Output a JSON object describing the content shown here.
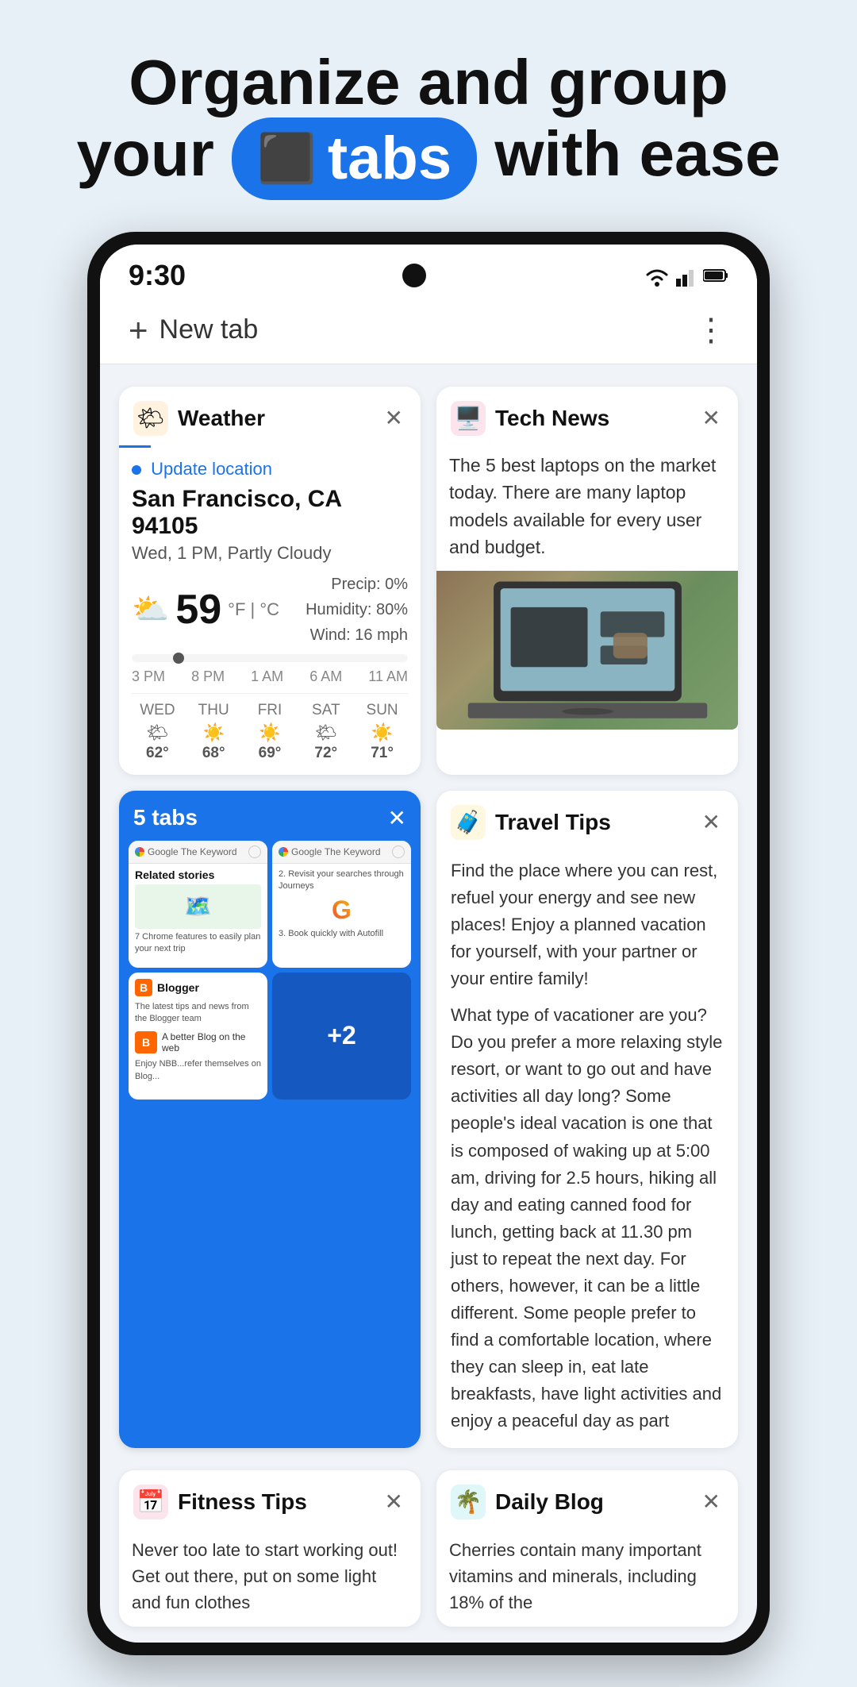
{
  "hero": {
    "line1": "Organize and group",
    "line2pre": "your",
    "badge_icon": "⬛",
    "badge_text": "tabs",
    "line2post": "with ease"
  },
  "phone": {
    "status": {
      "time": "9:30"
    },
    "nav": {
      "new_tab_label": "New tab"
    },
    "weather_card": {
      "title": "Weather",
      "update_text": "Update location",
      "location": "San Francisco, CA 94105",
      "conditions": "Wed, 1 PM, Partly Cloudy",
      "temp": "59",
      "temp_unit": "°F | °C",
      "precip": "Precip: 0%",
      "humidity": "Humidity: 80%",
      "wind": "Wind: 16 mph",
      "timeline_labels": [
        "3 PM",
        "8 PM",
        "1 AM",
        "6 AM",
        "11 AM"
      ],
      "forecast": [
        {
          "day": "WED",
          "icon": "🌤",
          "temp": "62°"
        },
        {
          "day": "THU",
          "icon": "☀️",
          "temp": "68°"
        },
        {
          "day": "FRI",
          "icon": "☀️",
          "temp": "69°"
        },
        {
          "day": "SAT",
          "icon": "🌤",
          "temp": "72°"
        },
        {
          "day": "SUN",
          "icon": "☀️",
          "temp": "71°"
        }
      ]
    },
    "tech_card": {
      "title": "Tech News",
      "text": "The 5 best laptops on the market today. There are many laptop models available for every user and budget."
    },
    "tabs_group": {
      "count_label": "5 tabs",
      "plus2_label": "+2"
    },
    "travel_card": {
      "title": "Travel Tips",
      "text1": "Find the place where you can rest, refuel your energy and see new places! Enjoy a planned vacation for yourself, with your partner or your entire family!",
      "text2": "What type of vacationer are you? Do you prefer a more relaxing style resort, or want to go out and have activities all day long? Some people's ideal vacation is one that is composed of waking up at 5:00 am, driving for 2.5 hours, hiking all day and eating canned food for lunch, getting back at 11.30 pm just to repeat the next day. For others, however, it can be a little different. Some people prefer to find a comfortable location, where they can sleep in, eat late breakfasts, have light activities and enjoy a peaceful day as part"
    },
    "fitness_card": {
      "title": "Fitness Tips",
      "text": "Never too late to start working out! Get out there, put on some light and fun clothes"
    },
    "blog_card": {
      "title": "Daily Blog",
      "text": "Cherries contain many important vitamins and minerals, including 18% of the"
    }
  }
}
